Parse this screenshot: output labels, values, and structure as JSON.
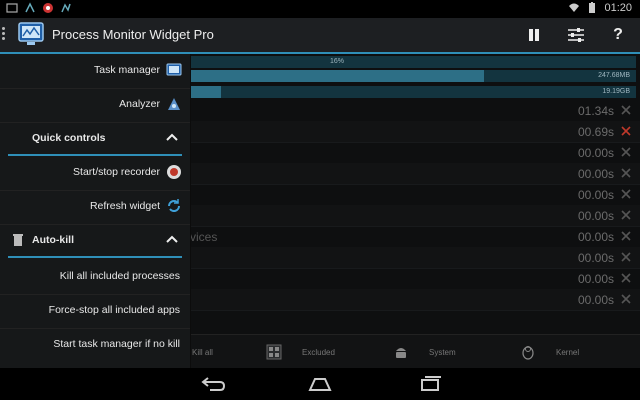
{
  "status_bar": {
    "left_icons": [
      "notification-icon-1",
      "notification-icon-2",
      "notification-icon-3",
      "notification-icon-4"
    ],
    "time": "01:20",
    "right_icons": [
      "wifi-icon",
      "battery-icon"
    ]
  },
  "action_bar": {
    "title": "Process Monitor Widget Pro",
    "pause_icon": "pause-icon",
    "settings_icon": "tune-icon",
    "help_label": "?"
  },
  "usage": {
    "cpu_percent_label": "16%",
    "memory_label": "247.68MB",
    "storage_label": "19.19GB",
    "memory_fill": 0.66,
    "storage_fill": 0.07
  },
  "processes": [
    {
      "time": "01.34s",
      "icon": "kill-icon-gray"
    },
    {
      "time": "00.69s",
      "icon": "kill-icon-red"
    },
    {
      "time": "00.00s",
      "icon": "kill-icon-gray"
    },
    {
      "time": "00.00s",
      "icon": "kill-icon-gray"
    },
    {
      "time": "00.00s",
      "icon": "kill-icon-gray"
    },
    {
      "time": "00.00s",
      "icon": "kill-icon-gray"
    },
    {
      "time": "00.00s",
      "icon": "kill-icon-gray"
    },
    {
      "time": "00.00s",
      "icon": "kill-icon-gray"
    },
    {
      "time": "00.00s",
      "icon": "kill-icon-gray"
    },
    {
      "time": "00.00s",
      "icon": "kill-icon-gray"
    }
  ],
  "services_partial": "vices",
  "bottom_tabs": [
    {
      "label": "Kill all"
    },
    {
      "label": "Excluded"
    },
    {
      "label": "System"
    },
    {
      "label": "Kernel"
    }
  ],
  "drawer": {
    "task_manager": "Task manager",
    "analyzer": "Analyzer",
    "quick_controls": "Quick controls",
    "start_stop_recorder": "Start/stop recorder",
    "refresh_widget": "Refresh widget",
    "auto_kill": "Auto-kill",
    "kill_all_included": "Kill all included processes",
    "force_stop_all": "Force-stop all included apps",
    "start_task_manager": "Start task manager if no kill"
  },
  "colors": {
    "accent": "#2f8fb8",
    "bar_bg": "#13343f",
    "bar_fill": "#2d6f86",
    "kill_red": "#c0392b"
  }
}
